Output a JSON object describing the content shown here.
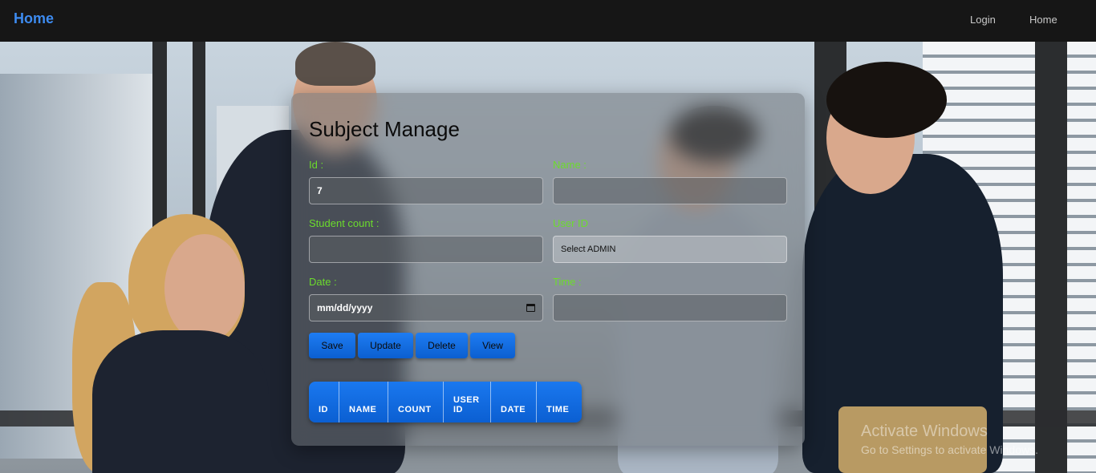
{
  "nav": {
    "brand": "Home",
    "links": [
      "Login",
      "Home"
    ]
  },
  "form": {
    "title": "Subject Manage",
    "fields": {
      "id": {
        "label": "Id :",
        "value": "7"
      },
      "name": {
        "label": "Name :",
        "value": ""
      },
      "student_count": {
        "label": "Student count :",
        "value": ""
      },
      "user_id": {
        "label": "User ID",
        "value": "Select ADMIN"
      },
      "date": {
        "label": "Date :",
        "value": "mm/dd/yyyy"
      },
      "time": {
        "label": "Time :",
        "value": ""
      }
    },
    "buttons": [
      "Save",
      "Update",
      "Delete",
      "View"
    ]
  },
  "table": {
    "columns": [
      "ID",
      "NAME",
      "COUNT",
      "USER ID",
      "DATE",
      "TIME"
    ]
  },
  "watermark": {
    "title": "Activate Windows",
    "subtitle": "Go to Settings to activate Windows."
  },
  "colors": {
    "brand": "#3d8bf0",
    "label": "#6cdc2c",
    "button": "#1e7cf2",
    "navbar": "#161616"
  },
  "icons": {
    "date_picker": "calendar-icon"
  }
}
